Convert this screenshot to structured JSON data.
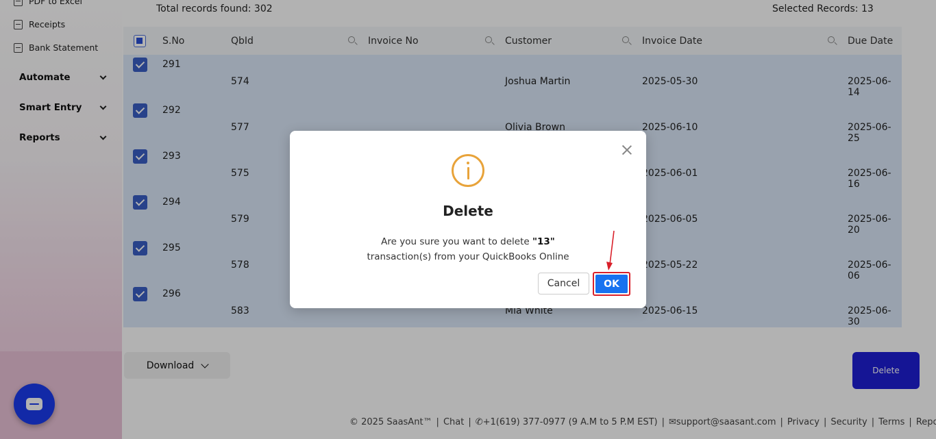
{
  "sidebar": {
    "sub_items": [
      "PDF to Excel",
      "Receipts",
      "Bank Statement"
    ],
    "groups": [
      "Automate",
      "Smart Entry",
      "Reports"
    ]
  },
  "main": {
    "total_records": "Total records found: 302",
    "selected_records": "Selected Records: 13"
  },
  "table": {
    "columns": [
      "S.No",
      "QbId",
      "Invoice No",
      "Customer",
      "Invoice Date",
      "Due Date"
    ],
    "rows": [
      {
        "sno": "291",
        "qbid": "574",
        "invoice_no": "",
        "customer": "Joshua Martin",
        "invoice_date": "2025-05-30",
        "due_date": "2025-06-14"
      },
      {
        "sno": "292",
        "qbid": "577",
        "invoice_no": "",
        "customer": "Olivia Brown",
        "invoice_date": "2025-06-10",
        "due_date": "2025-06-25"
      },
      {
        "sno": "293",
        "qbid": "575",
        "invoice_no": "",
        "customer": "",
        "invoice_date": "2025-06-01",
        "due_date": "2025-06-16"
      },
      {
        "sno": "294",
        "qbid": "579",
        "invoice_no": "",
        "customer": "",
        "invoice_date": "2025-06-05",
        "due_date": "2025-06-20"
      },
      {
        "sno": "295",
        "qbid": "578",
        "invoice_no": "",
        "customer": "",
        "invoice_date": "2025-05-22",
        "due_date": "2025-06-06"
      },
      {
        "sno": "296",
        "qbid": "583",
        "invoice_no": "",
        "customer": "Mia White",
        "invoice_date": "2025-06-15",
        "due_date": "2025-06-30"
      }
    ]
  },
  "actions": {
    "download_label": "Download",
    "delete_label": "Delete"
  },
  "footer": {
    "copyright": "© 2025 SaasAnt™",
    "chat": "Chat",
    "phone": "+1(619) 377-0977 (9 A.M to 5 P.M EST)",
    "email": "support@saasant.com",
    "privacy": "Privacy",
    "security": "Security",
    "terms": "Terms",
    "report": "Report feature"
  },
  "modal": {
    "title": "Delete",
    "message_prefix": "Are you sure you want to delete ",
    "count": "\"13\"",
    "message_suffix": "transaction(s) from your QuickBooks Online",
    "cancel_label": "Cancel",
    "ok_label": "OK",
    "icon": "info-icon",
    "highlight_color": "#d9202a"
  }
}
